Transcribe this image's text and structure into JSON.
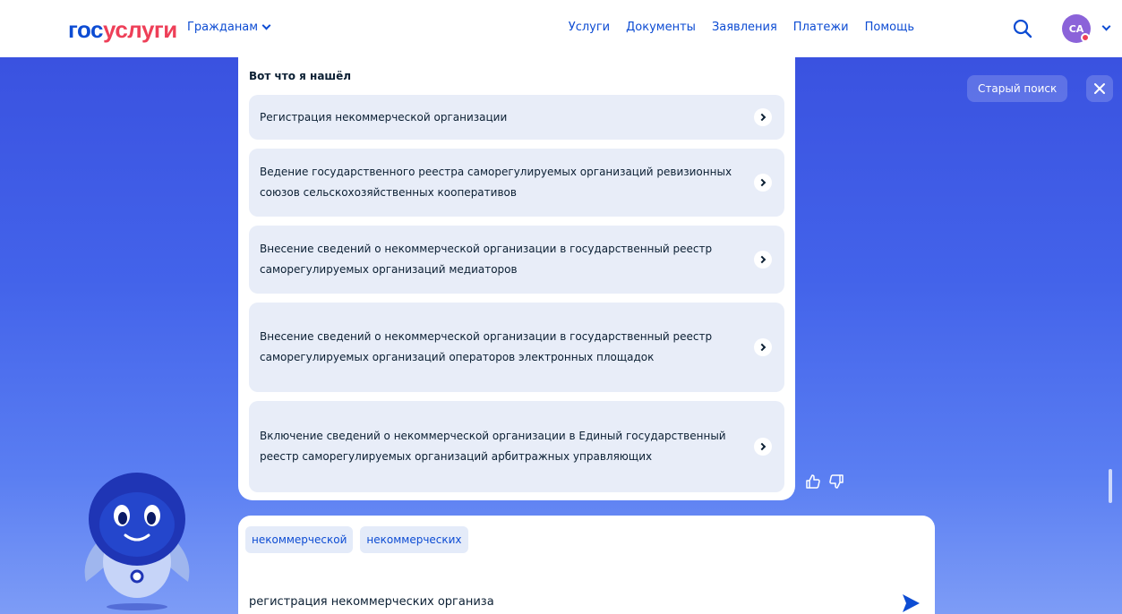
{
  "header": {
    "logo_part1": "гос",
    "logo_part2": "услуги",
    "audience": "Гражданам",
    "nav": [
      "Услуги",
      "Документы",
      "Заявления",
      "Платежи",
      "Помощь"
    ],
    "avatar_initials": "СА",
    "search_icon": "search-icon"
  },
  "top_actions": {
    "old_search": "Старый поиск",
    "close_icon": "close-icon"
  },
  "results": {
    "title": "Вот что я нашёл",
    "items": [
      "Регистрация некоммерческой организации",
      "Ведение государственного реестра саморегулируемых организаций ревизионных союзов сельскохозяйственных кооперативов",
      "Внесение сведений о некоммерческой организации в государственный реестр саморегулируемых организаций медиаторов",
      "Внесение сведений о некоммерческой организации в государственный реестр саморегулируемых организаций операторов электронных площадок",
      "Включение сведений о некоммерческой организации в Единый государственный реестр саморегулируемых организаций арбитражных управляющих"
    ]
  },
  "feedback": {
    "like_icon": "thumbs-up-icon",
    "dislike_icon": "thumbs-down-icon"
  },
  "search": {
    "suggestions": [
      "некоммерческой",
      "некоммерческих"
    ],
    "query": "регистрация некоммерческих организа",
    "send_icon": "send-icon"
  },
  "colors": {
    "brand_blue": "#0d4cd3",
    "brand_red": "#ee3f58",
    "backdrop": "#4363ea",
    "item_bg": "#e8edf8"
  }
}
